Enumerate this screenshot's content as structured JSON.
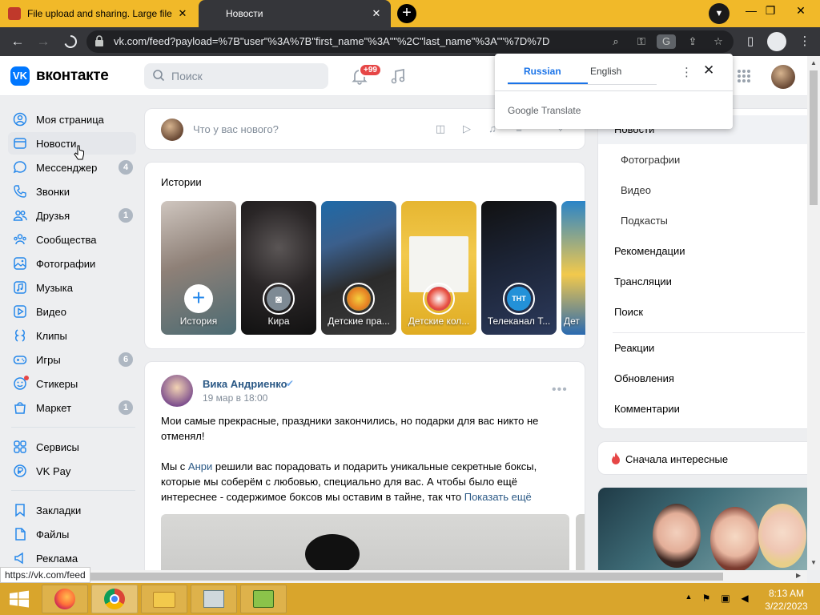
{
  "browser": {
    "tabs": [
      {
        "title": "File upload and sharing. Large file",
        "active": false
      },
      {
        "title": "Новости",
        "active": true
      }
    ],
    "url": "vk.com/feed?payload=%7B\"user\"%3A%7B\"first_name\"%3A\"\"%2C\"last_name\"%3A\"\"%7D%7D",
    "status_url": "https://vk.com/feed"
  },
  "translate_popup": {
    "tab_source": "Russian",
    "tab_target": "English",
    "brand": "Google Translate"
  },
  "vk": {
    "logo_text": "вконтакте",
    "search_placeholder": "Поиск",
    "notifications_badge": "+99",
    "left_nav": [
      {
        "label": "Моя страница",
        "icon": "user-icon",
        "badge": ""
      },
      {
        "label": "Новости",
        "icon": "news-icon",
        "badge": "",
        "active": true
      },
      {
        "label": "Мессенджер",
        "icon": "chat-icon",
        "badge": "4"
      },
      {
        "label": "Звонки",
        "icon": "phone-icon",
        "badge": ""
      },
      {
        "label": "Друзья",
        "icon": "friends-icon",
        "badge": "1"
      },
      {
        "label": "Сообщества",
        "icon": "communities-icon",
        "badge": ""
      },
      {
        "label": "Фотографии",
        "icon": "photo-icon",
        "badge": ""
      },
      {
        "label": "Музыка",
        "icon": "music-icon",
        "badge": ""
      },
      {
        "label": "Видео",
        "icon": "video-icon",
        "badge": ""
      },
      {
        "label": "Клипы",
        "icon": "clips-icon",
        "badge": ""
      },
      {
        "label": "Игры",
        "icon": "games-icon",
        "badge": "6"
      },
      {
        "label": "Стикеры",
        "icon": "stickers-icon",
        "badge": ""
      },
      {
        "label": "Маркет",
        "icon": "market-icon",
        "badge": "1"
      },
      {
        "label": "Сервисы",
        "icon": "services-icon",
        "badge": ""
      },
      {
        "label": "VK Pay",
        "icon": "vkpay-icon",
        "badge": ""
      },
      {
        "label": "Закладки",
        "icon": "bookmark-icon",
        "badge": ""
      },
      {
        "label": "Файлы",
        "icon": "files-icon",
        "badge": ""
      },
      {
        "label": "Реклама",
        "icon": "ads-icon",
        "badge": ""
      }
    ],
    "new_post_placeholder": "Что у вас нового?",
    "stories_title": "Истории",
    "stories": [
      {
        "name": "История"
      },
      {
        "name": "Кира"
      },
      {
        "name": "Детские пра..."
      },
      {
        "name": "Детские кол..."
      },
      {
        "name": "Телеканал Т..."
      },
      {
        "name": "Дет"
      }
    ],
    "post": {
      "author": "Вика Андриенко",
      "date": "19 мар в 18:00",
      "para1": "Мои самые прекрасные, праздники закончились, но подарки для вас никто не отменял!",
      "para2_start": "Мы с ",
      "para2_link": "Анри",
      "para2_rest": " решили вас порадовать и подарить уникальные секретные боксы, которые мы соберём с любовью, специально для вас. А чтобы было ещё интереснее - содержимое боксов мы оставим в тайне, так что ",
      "show_more": "Показать ещё"
    },
    "right_menu": {
      "items": [
        {
          "label": "Новости",
          "sub": false,
          "active": true
        },
        {
          "label": "Фотографии",
          "sub": true
        },
        {
          "label": "Видео",
          "sub": true
        },
        {
          "label": "Подкасты",
          "sub": true
        },
        {
          "label": "Рекомендации",
          "sub": false
        },
        {
          "label": "Трансляции",
          "sub": false
        },
        {
          "label": "Поиск",
          "sub": false
        },
        {
          "label": "Реакции",
          "sub": false
        },
        {
          "label": "Обновления",
          "sub": false
        },
        {
          "label": "Комментарии",
          "sub": false
        }
      ],
      "sort_label": "Сначала интересные"
    }
  },
  "taskbar": {
    "time": "8:13 AM",
    "date": "3/22/2023"
  }
}
